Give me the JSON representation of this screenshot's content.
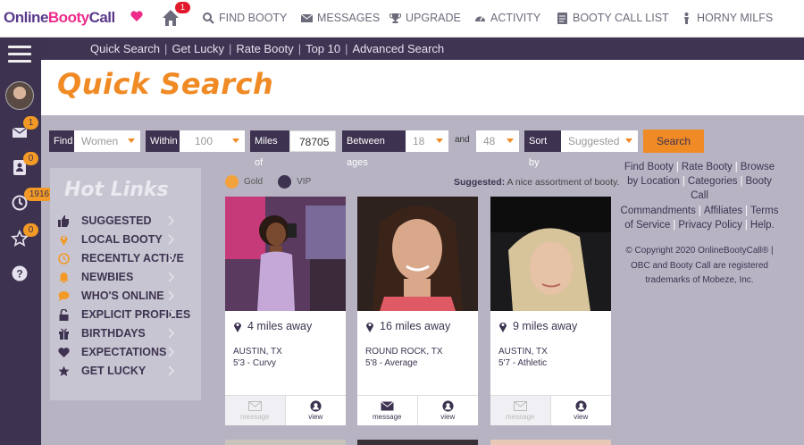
{
  "brand": {
    "part1": "Online",
    "part2": "Booty",
    "part3": "Call"
  },
  "topnav": {
    "home_badge": "1",
    "items": [
      {
        "label": "FIND BOOTY",
        "icon": "search-icon"
      },
      {
        "label": "MESSAGES",
        "icon": "envelope-icon"
      },
      {
        "label": "UPGRADE",
        "icon": "trophy-icon"
      },
      {
        "label": "ACTIVITY",
        "icon": "gauge-icon"
      },
      {
        "label": "BOOTY CALL LIST",
        "icon": "list-icon"
      },
      {
        "label": "HORNY MILFS",
        "icon": "person-icon"
      }
    ]
  },
  "subnav": [
    "Quick Search",
    "Get Lucky",
    "Rate Booty",
    "Top 10",
    "Advanced Search"
  ],
  "sidebar": {
    "badges": {
      "messages": "1",
      "profile": "0",
      "history": "1916",
      "favorites": "0"
    }
  },
  "page_title": "Quick Search",
  "filters": {
    "find_label": "Find",
    "find_value": "Women",
    "within_label": "Within",
    "within_value": "100",
    "miles_label": "Miles of",
    "zip_value": "78705",
    "ages_label": "Between ages",
    "age_min": "18",
    "and_label": "and",
    "age_max": "48",
    "sort_label": "Sort by",
    "sort_value": "Suggested",
    "search_button": "Search"
  },
  "hotlinks": {
    "title": "Hot Links",
    "items": [
      {
        "label": "SUGGESTED",
        "icon": "thumbs-up-icon"
      },
      {
        "label": "LOCAL BOOTY",
        "icon": "map-pin-icon"
      },
      {
        "label": "RECENTLY ACTIVE",
        "icon": "clock-icon"
      },
      {
        "label": "NEWBIES",
        "icon": "bell-icon"
      },
      {
        "label": "WHO'S ONLINE",
        "icon": "chat-icon"
      },
      {
        "label": "EXPLICIT PROFILES",
        "icon": "unlock-icon"
      },
      {
        "label": "BIRTHDAYS",
        "icon": "gift-icon"
      },
      {
        "label": "EXPECTATIONS",
        "icon": "heart-icon"
      },
      {
        "label": "GET LUCKY",
        "icon": "star-icon"
      }
    ]
  },
  "legend": {
    "gold": "Gold",
    "vip": "VIP",
    "gold_color": "#f2a23b",
    "vip_color": "#3d3350"
  },
  "suggested_note": {
    "bold": "Suggested:",
    "text": " A nice assortment of booty."
  },
  "profiles": [
    {
      "distance": "4 miles away",
      "city": "AUSTIN, TX",
      "bio": "5'3 - Curvy",
      "message_label": "message",
      "view_label": "view",
      "messaged": false
    },
    {
      "distance": "16 miles away",
      "city": "ROUND ROCK, TX",
      "bio": "5'8 - Average",
      "message_label": "message",
      "view_label": "view",
      "messaged": true
    },
    {
      "distance": "9 miles away",
      "city": "AUSTIN, TX",
      "bio": "5'7 - Athletic",
      "message_label": "message",
      "view_label": "view",
      "messaged": false
    }
  ],
  "footer": {
    "links": [
      "Find Booty",
      "Rate Booty",
      "Browse by Location",
      "Categories",
      "Booty Call Commandments",
      "Affiliates",
      "Terms of Service",
      "Privacy Policy",
      "Help."
    ],
    "copyright": "© Copyright 2020 OnlineBootyCall® | OBC and Booty Call are registered trademarks of Mobeze, Inc."
  },
  "colors": {
    "accent": "#f08a24",
    "dark": "#3d3350",
    "background": "#b7b3c3",
    "badge_red": "#e2192c"
  }
}
